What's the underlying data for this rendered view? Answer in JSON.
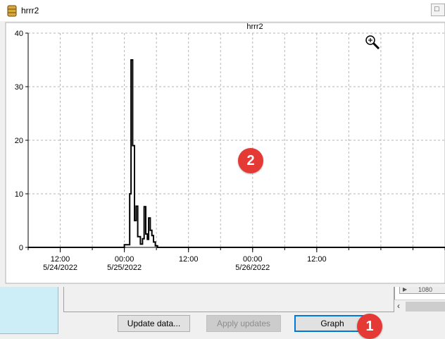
{
  "window": {
    "title": "hrrr2",
    "close_glyph": "□"
  },
  "chart_data": {
    "type": "line",
    "title": "hrrr2",
    "xlabel": "",
    "ylabel": "",
    "ylim": [
      0,
      40
    ],
    "yticks": [
      0,
      10,
      20,
      30,
      40
    ],
    "x_range_hours": [
      -18,
      60
    ],
    "xticks": [
      {
        "hour": -12,
        "lines": [
          "12:00",
          "5/24/2022"
        ]
      },
      {
        "hour": 0,
        "lines": [
          "00:00",
          "5/25/2022"
        ]
      },
      {
        "hour": 12,
        "lines": [
          "12:00",
          ""
        ]
      },
      {
        "hour": 24,
        "lines": [
          "00:00",
          "5/26/2022"
        ]
      },
      {
        "hour": 36,
        "lines": [
          "12:00",
          ""
        ]
      }
    ],
    "grid": true,
    "series": [
      {
        "color": "#000000",
        "step": true,
        "points": [
          [
            -18,
            0
          ],
          [
            0,
            0
          ],
          [
            0,
            0.5
          ],
          [
            1,
            0.5
          ],
          [
            1,
            10
          ],
          [
            1.25,
            10
          ],
          [
            1.25,
            35
          ],
          [
            1.55,
            35
          ],
          [
            1.55,
            19
          ],
          [
            1.9,
            19
          ],
          [
            1.9,
            5
          ],
          [
            2.2,
            5
          ],
          [
            2.2,
            7.7
          ],
          [
            2.5,
            7.7
          ],
          [
            2.5,
            2
          ],
          [
            3,
            2
          ],
          [
            3,
            0.6
          ],
          [
            3.4,
            0.6
          ],
          [
            3.4,
            1.6
          ],
          [
            3.7,
            1.6
          ],
          [
            3.7,
            7.6
          ],
          [
            4,
            7.6
          ],
          [
            4,
            2.5
          ],
          [
            4.3,
            2.5
          ],
          [
            4.3,
            1.5
          ],
          [
            4.55,
            1.5
          ],
          [
            4.55,
            5.5
          ],
          [
            4.85,
            5.5
          ],
          [
            4.85,
            3.2
          ],
          [
            5.15,
            3.2
          ],
          [
            5.15,
            2.2
          ],
          [
            5.45,
            2.2
          ],
          [
            5.45,
            1
          ],
          [
            5.8,
            1
          ],
          [
            5.8,
            0.3
          ],
          [
            6.2,
            0.3
          ],
          [
            6.2,
            0
          ],
          [
            60,
            0
          ]
        ]
      }
    ]
  },
  "buttons": {
    "update": "Update data...",
    "apply": "Apply updates",
    "graph": "Graph"
  },
  "grid_cell": "1080",
  "badges": {
    "one": "1",
    "two": "2"
  },
  "icons": {
    "zoom": "zoom-in-icon",
    "app": "database-icon"
  },
  "colors": {
    "badge": "#e53935",
    "focus": "#0078d7",
    "side_panel": "#cdeef6"
  }
}
